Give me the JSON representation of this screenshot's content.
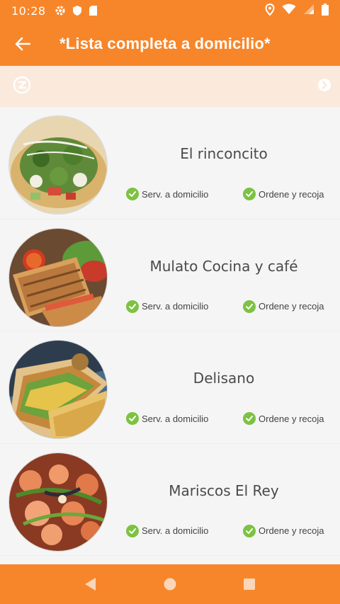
{
  "status_bar": {
    "time": "10:28",
    "left_icons": [
      "gear-icon",
      "shield-icon",
      "sd-card-icon"
    ],
    "right_icons": [
      "location-pin-icon",
      "wifi-icon",
      "signal-icon",
      "battery-icon"
    ]
  },
  "app_bar": {
    "title": "*Lista completa a domicilio*",
    "back_icon": "arrow-left-icon",
    "color": "#f7862a"
  },
  "promo_strip": {
    "left_icon": "brand-logo-icon",
    "right_icon": "chevron-right-circle-icon",
    "background": "#fbe9dc"
  },
  "restaurants": [
    {
      "name": "El rinconcito",
      "image": "tostada-salad-photo",
      "delivery_label": "Serv. a domicilio",
      "pickup_label": "Ordene y recoja"
    },
    {
      "name": "Mulato Cocina y café",
      "image": "panini-sandwich-photo",
      "delivery_label": "Serv. a domicilio",
      "pickup_label": "Ordene y recoja"
    },
    {
      "name": "Delisano",
      "image": "toasted-sandwich-photo",
      "delivery_label": "Serv. a domicilio",
      "pickup_label": "Ordene y recoja"
    },
    {
      "name": "Mariscos El Rey",
      "image": "shrimp-dish-photo",
      "delivery_label": "Serv. a domicilio",
      "pickup_label": "Ordene y recoja"
    }
  ],
  "check_color": "#7dc242",
  "nav_bar": {
    "buttons": [
      "back-triangle-icon",
      "home-circle-icon",
      "recents-square-icon"
    ]
  }
}
